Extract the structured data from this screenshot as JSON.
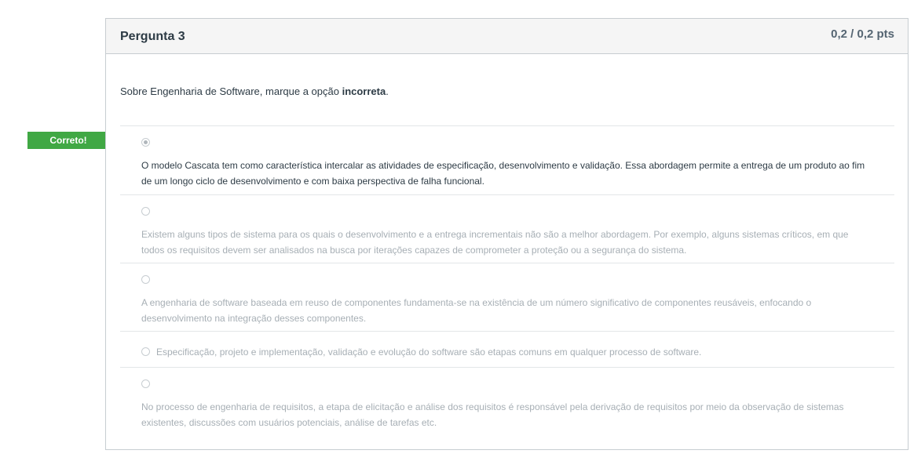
{
  "question": {
    "title": "Pergunta 3",
    "points": "0,2 / 0,2 pts",
    "text_before": "Sobre Engenharia de Software, marque a opção ",
    "text_bold": "incorreta",
    "text_after": "."
  },
  "correct_flag": "Correto!",
  "answers": [
    {
      "text": "O modelo Cascata tem como característica intercalar as atividades de especificação, desenvolvimento e validação. Essa abordagem permite a entrega de um produto ao fim de um longo ciclo de desenvolvimento e com baixa perspectiva de falha funcional.",
      "selected": true,
      "correct": true
    },
    {
      "text": "Existem alguns tipos de sistema para os quais o desenvolvimento e a entrega incrementais não são a melhor abordagem. Por exemplo, alguns sistemas críticos, em que todos os requisitos devem ser analisados na busca por iterações capazes de comprometer a proteção ou a segurança do sistema.",
      "selected": false,
      "correct": false
    },
    {
      "text": "A engenharia de software baseada em reuso de componentes fundamenta-se na existência de um número significativo de componentes reusáveis, enfocando o desenvolvimento na integração desses componentes.",
      "selected": false,
      "correct": false
    },
    {
      "text": "Especificação, projeto e implementação, validação e evolução do software são etapas comuns em qualquer processo de software.",
      "selected": false,
      "correct": false
    },
    {
      "text": "No processo de engenharia de requisitos, a etapa de elicitação e análise dos requisitos é responsável pela derivação de requisitos por meio da observação de sistemas existentes, discussões com usuários potenciais, análise de tarefas etc.",
      "selected": false,
      "correct": false
    }
  ]
}
